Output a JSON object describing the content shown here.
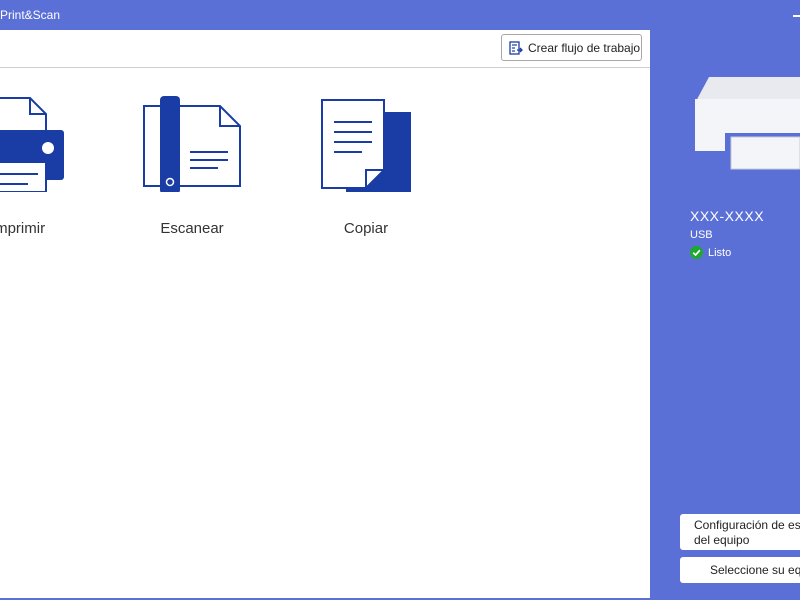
{
  "window": {
    "title": "Print&Scan"
  },
  "toolbar": {
    "workflow_label": "Crear flujo de trabajo"
  },
  "tiles": [
    {
      "label": "Imprimir",
      "icon": "printer-icon"
    },
    {
      "label": "Escanear",
      "icon": "scanner-icon"
    },
    {
      "label": "Copiar",
      "icon": "copy-icon"
    }
  ],
  "device": {
    "model": "XXX-XXXX",
    "connection": "USB",
    "status": "Listo",
    "status_color": "#1fa82e"
  },
  "side_buttons": {
    "scan_settings_line1": "Configuración de escaneo",
    "scan_settings_line2": "del equipo",
    "select_device": "Seleccione su equipo"
  },
  "colors": {
    "accent": "#5b70d6",
    "icon_blue": "#1a3da5"
  }
}
